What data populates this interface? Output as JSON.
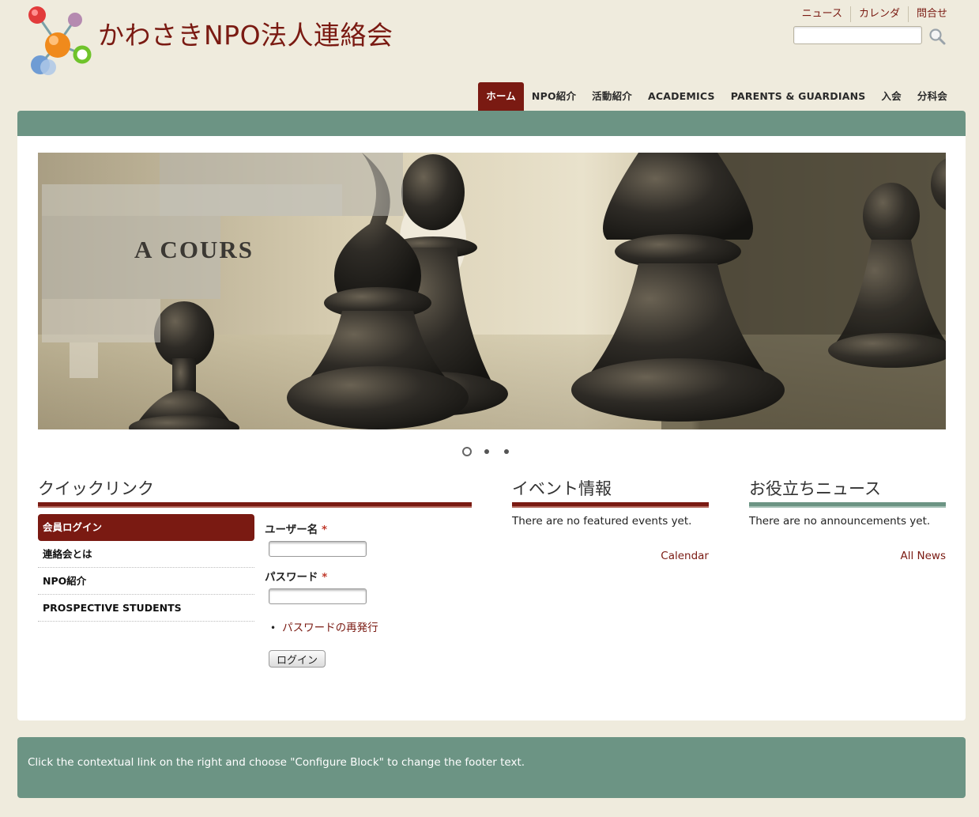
{
  "header": {
    "site_title": "かわさきNPO法人連絡会",
    "logo": "molecule-logo",
    "util_links": [
      "ニュース",
      "カレンダ",
      "問合せ"
    ],
    "search": {
      "value": "",
      "placeholder": ""
    }
  },
  "nav": {
    "items": [
      "ホーム",
      "NPO紹介",
      "活動紹介",
      "ACADEMICS",
      "PARENTS & GUARDIANS",
      "入会",
      "分科会"
    ],
    "active_index": 0
  },
  "slideshow": {
    "overlay_text": "A COURS",
    "dots": 3,
    "active_dot": 0
  },
  "quicklinks": {
    "title": "クイックリンク",
    "items": [
      "会員ログイン",
      "連絡会とは",
      "NPO紹介",
      "PROSPECTIVE STUDENTS"
    ],
    "active_index": 0
  },
  "login": {
    "username_label": "ユーザー名",
    "password_label": "パスワード",
    "required_mark": "*",
    "reset_link": "パスワードの再発行",
    "bullet": "•",
    "submit_label": "ログイン",
    "username_value": "",
    "password_value": ""
  },
  "events": {
    "title": "イベント情報",
    "empty_text": "There are no featured events yet.",
    "link": "Calendar"
  },
  "news": {
    "title": "お役立ちニュース",
    "empty_text": "There are no announcements yet.",
    "link": "All News"
  },
  "footer": {
    "text": "Click the contextual link on the right and choose \"Configure Block\" to change the footer text."
  },
  "colors": {
    "brand_red": "#7a1a12",
    "green": "#6c9484",
    "background": "#efebdd"
  }
}
